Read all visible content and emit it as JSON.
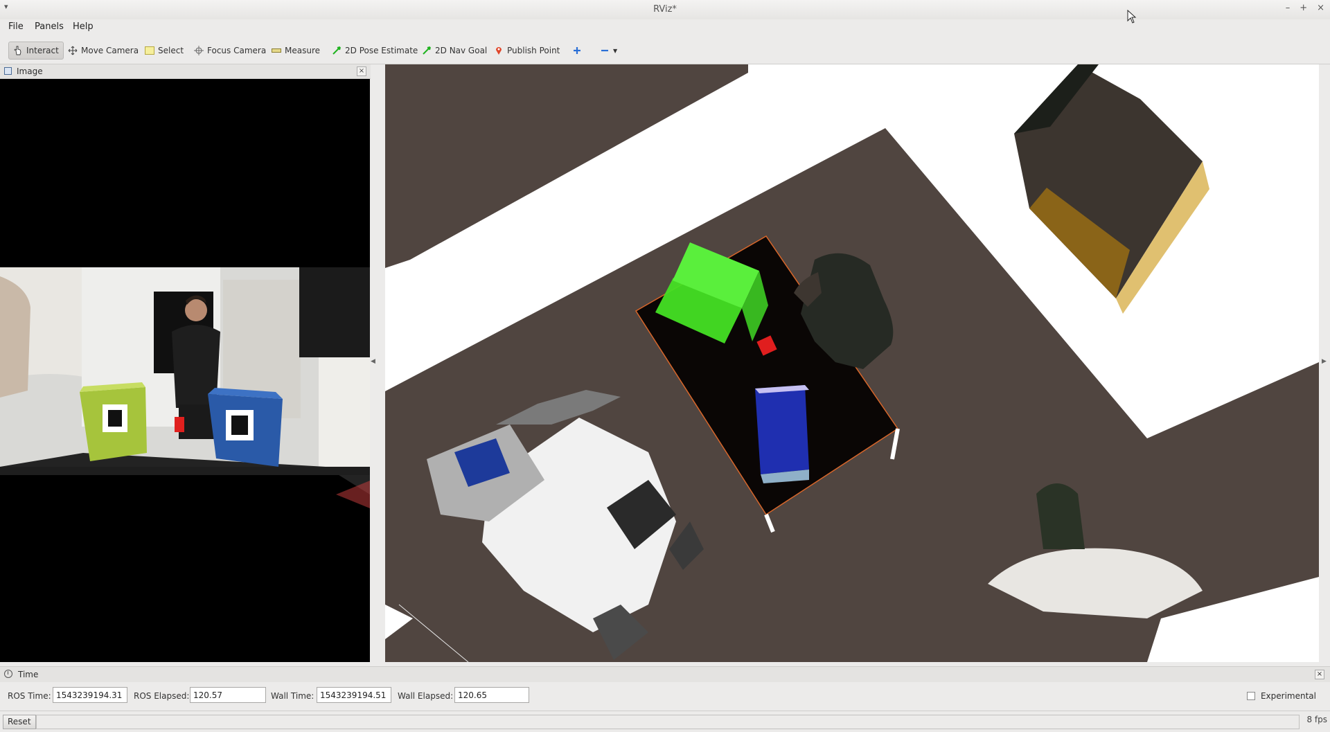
{
  "window": {
    "title": "RViz*",
    "controls": [
      "–",
      "+",
      "×"
    ]
  },
  "menu": {
    "file": "File",
    "panels": "Panels",
    "help": "Help"
  },
  "toolbar": {
    "interact": "Interact",
    "move_camera": "Move Camera",
    "select": "Select",
    "focus_camera": "Focus Camera",
    "measure": "Measure",
    "pose_estimate": "2D Pose Estimate",
    "nav_goal": "2D Nav Goal",
    "publish_point": "Publish Point",
    "colors": {
      "pose_arrow": "#1fb31f",
      "publish_point": "#e0462a",
      "plus": "#2a6fd6"
    }
  },
  "image_panel": {
    "title": "Image",
    "close": "×"
  },
  "view3d": {
    "colors": {
      "floor": "#504540",
      "table": "#0a0605",
      "table_edge": "#d8662a",
      "green_box": "#44e024",
      "blue_box": "#1f2fb0",
      "cup": "#e01e1e"
    }
  },
  "time_panel": {
    "title": "Time",
    "ros_time_label": "ROS Time:",
    "ros_time": "1543239194.31",
    "ros_elapsed_label": "ROS Elapsed:",
    "ros_elapsed": "120.57",
    "wall_time_label": "Wall Time:",
    "wall_time": "1543239194.51",
    "wall_elapsed_label": "Wall Elapsed:",
    "wall_elapsed": "120.65",
    "experimental_label": "Experimental",
    "experimental_checked": false
  },
  "status": {
    "reset_label": "Reset",
    "fps": "8 fps"
  }
}
